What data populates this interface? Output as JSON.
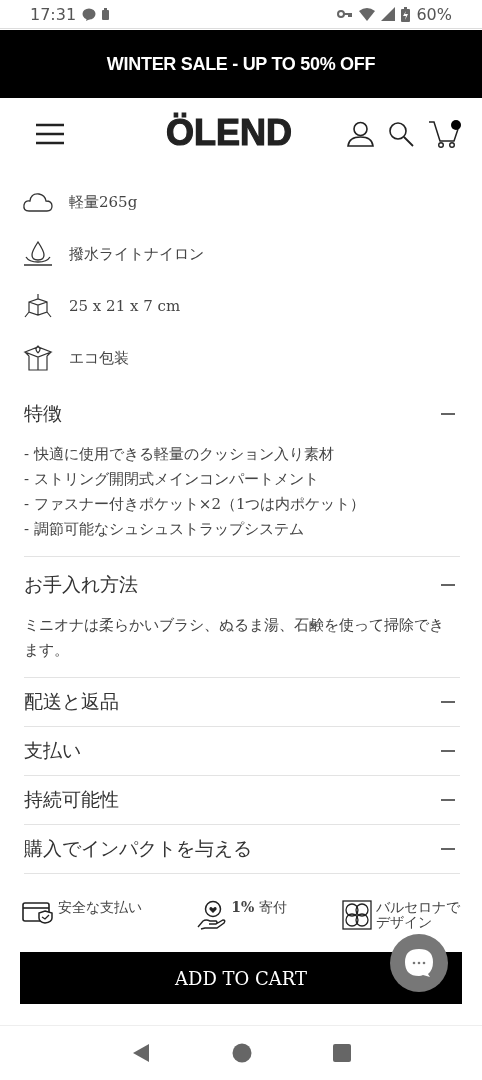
{
  "status_bar": {
    "time": "17:31",
    "battery": "60%"
  },
  "promo_banner": {
    "text": "WINTER SALE - UP TO 50% OFF"
  },
  "header": {
    "logo": "ÖLEND",
    "cart_has_items": true
  },
  "features": [
    {
      "kind": "cloud",
      "text": "軽量265g"
    },
    {
      "kind": "drop",
      "text": "撥水ライトナイロン"
    },
    {
      "kind": "cube",
      "text": "25 x 21 x 7 cm"
    },
    {
      "kind": "box",
      "text": "エコ包装"
    }
  ],
  "sections": [
    {
      "title": "特徴",
      "expanded": true,
      "lines": [
        "- 快適に使用できる軽量のクッション入り素材",
        "- ストリング開閉式メインコンパートメント",
        "- ファスナー付きポケット×2（1つは内ポケット）",
        "- 調節可能なシュシュストラップシステム"
      ]
    },
    {
      "title": "お手入れ方法",
      "expanded": true,
      "lines": [
        "ミニオナは柔らかいブラシ、ぬるま湯、石鹸を使って掃除できます。"
      ]
    },
    {
      "title": "配送と返品",
      "expanded": true
    },
    {
      "title": "支払い",
      "expanded": true
    },
    {
      "title": "持続可能性",
      "expanded": true
    },
    {
      "title": "購入でインパクトを与える",
      "expanded": true
    }
  ],
  "badges": [
    {
      "kind": "card",
      "text": "安全な支払い"
    },
    {
      "kind": "hand",
      "text": "**1%** 寄付"
    },
    {
      "kind": "flower",
      "text": "バルセロナでデザイン"
    }
  ],
  "add_to_cart": {
    "label": "ADD TO CART"
  }
}
